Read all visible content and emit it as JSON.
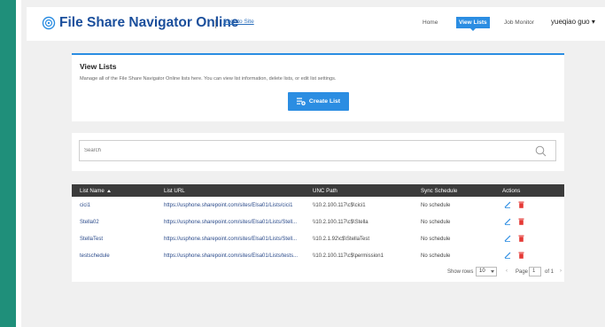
{
  "app": {
    "title": "File Share Navigator Online",
    "back_link": "Back to Site"
  },
  "nav": {
    "home": "Home",
    "view_lists": "View Lists",
    "job_monitor": "Job Monitor",
    "user": "yueqiao guo ▾"
  },
  "panel": {
    "title": "View Lists",
    "description": "Manage all of the File Share Navigator Online lists here. You can view list information, delete lists, or edit list settings.",
    "create_button": "Create List"
  },
  "search": {
    "placeholder": "Search"
  },
  "table": {
    "headers": {
      "name": "List Name",
      "url": "List URL",
      "unc": "UNC Path",
      "sync": "Sync Schedule",
      "actions": "Actions"
    },
    "rows": [
      {
        "name": "cici1",
        "url": "https://usphone.sharepoint.com/sites/Elsa01/Lists/cici1",
        "unc": "\\\\10.2.100.117\\c$\\cici1",
        "sync": "No schedule"
      },
      {
        "name": "Stella02",
        "url": "https://usphone.sharepoint.com/sites/Elsa01/Lists/Stell...",
        "unc": "\\\\10.2.100.117\\c$\\Stella",
        "sync": "No schedule"
      },
      {
        "name": "StellaTest",
        "url": "https://usphone.sharepoint.com/sites/Elsa01/Lists/Stell...",
        "unc": "\\\\10.2.1.92\\c$\\StellaTest",
        "sync": "No schedule"
      },
      {
        "name": "testschedule",
        "url": "https://usphone.sharepoint.com/sites/Elsa01/Lists/tests...",
        "unc": "\\\\10.2.100.117\\c$\\permission1",
        "sync": "No schedule"
      }
    ]
  },
  "pager": {
    "show_rows": "Show rows",
    "rows_value": "10",
    "page_label": "Page",
    "page_value": "1",
    "of_label": "of 1"
  },
  "colors": {
    "accent": "#2b8de2",
    "title": "#1b4f9c",
    "header_bg": "#3b3b3b",
    "delete": "#e53935",
    "strip": "#1f8f7a"
  }
}
